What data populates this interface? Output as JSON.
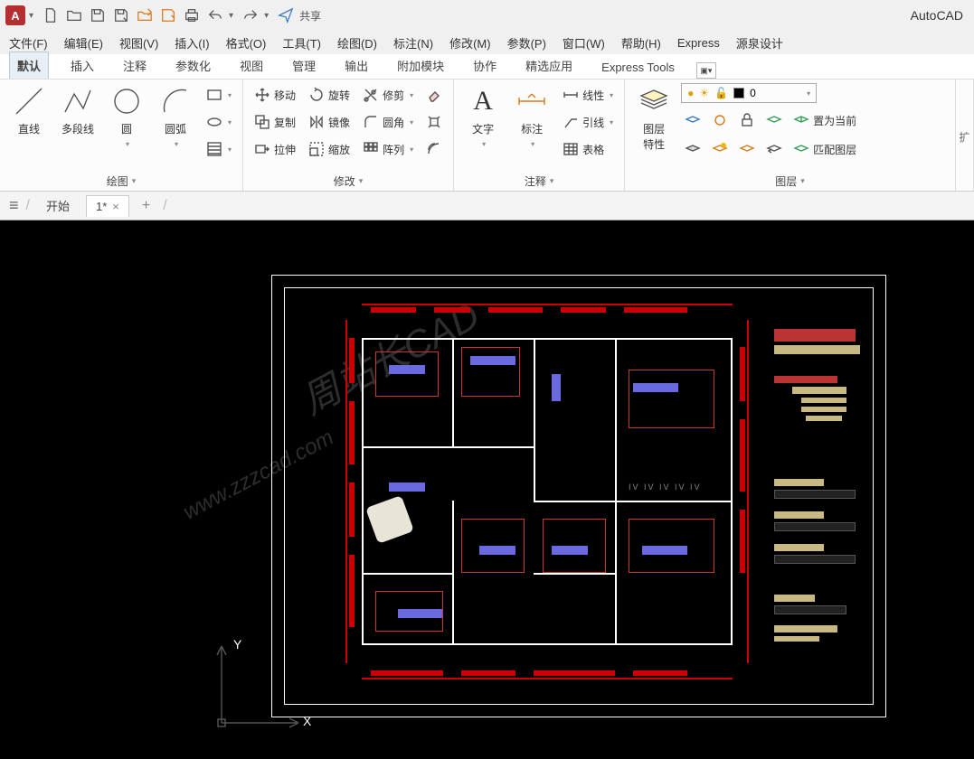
{
  "app": {
    "logo_letter": "A",
    "title": "AutoCAD",
    "share": "共享"
  },
  "menus": [
    "文件(F)",
    "编辑(E)",
    "视图(V)",
    "插入(I)",
    "格式(O)",
    "工具(T)",
    "绘图(D)",
    "标注(N)",
    "修改(M)",
    "参数(P)",
    "窗口(W)",
    "帮助(H)",
    "Express",
    "源泉设计"
  ],
  "ribbon_tabs": [
    "默认",
    "插入",
    "注释",
    "参数化",
    "视图",
    "管理",
    "输出",
    "附加模块",
    "协作",
    "精选应用",
    "Express Tools"
  ],
  "panels": {
    "draw": {
      "label": "绘图",
      "line": "直线",
      "polyline": "多段线",
      "circle": "圆",
      "arc": "圆弧"
    },
    "modify": {
      "label": "修改",
      "move": "移动",
      "rotate": "旋转",
      "trim": "修剪",
      "copy": "复制",
      "mirror": "镜像",
      "fillet": "圆角",
      "stretch": "拉伸",
      "scale": "缩放",
      "array": "阵列"
    },
    "annot": {
      "label": "注释",
      "text": "文字",
      "dim": "标注",
      "linetype": "线性",
      "leader": "引线",
      "table": "表格"
    },
    "layer": {
      "label": "图层",
      "props": "图层\n特性",
      "current": "0",
      "setcurrent": "置为当前",
      "match": "匹配图层"
    }
  },
  "filetabs": {
    "start": "开始",
    "doc": "1*"
  },
  "ucs": {
    "x": "X",
    "y": "Y"
  }
}
